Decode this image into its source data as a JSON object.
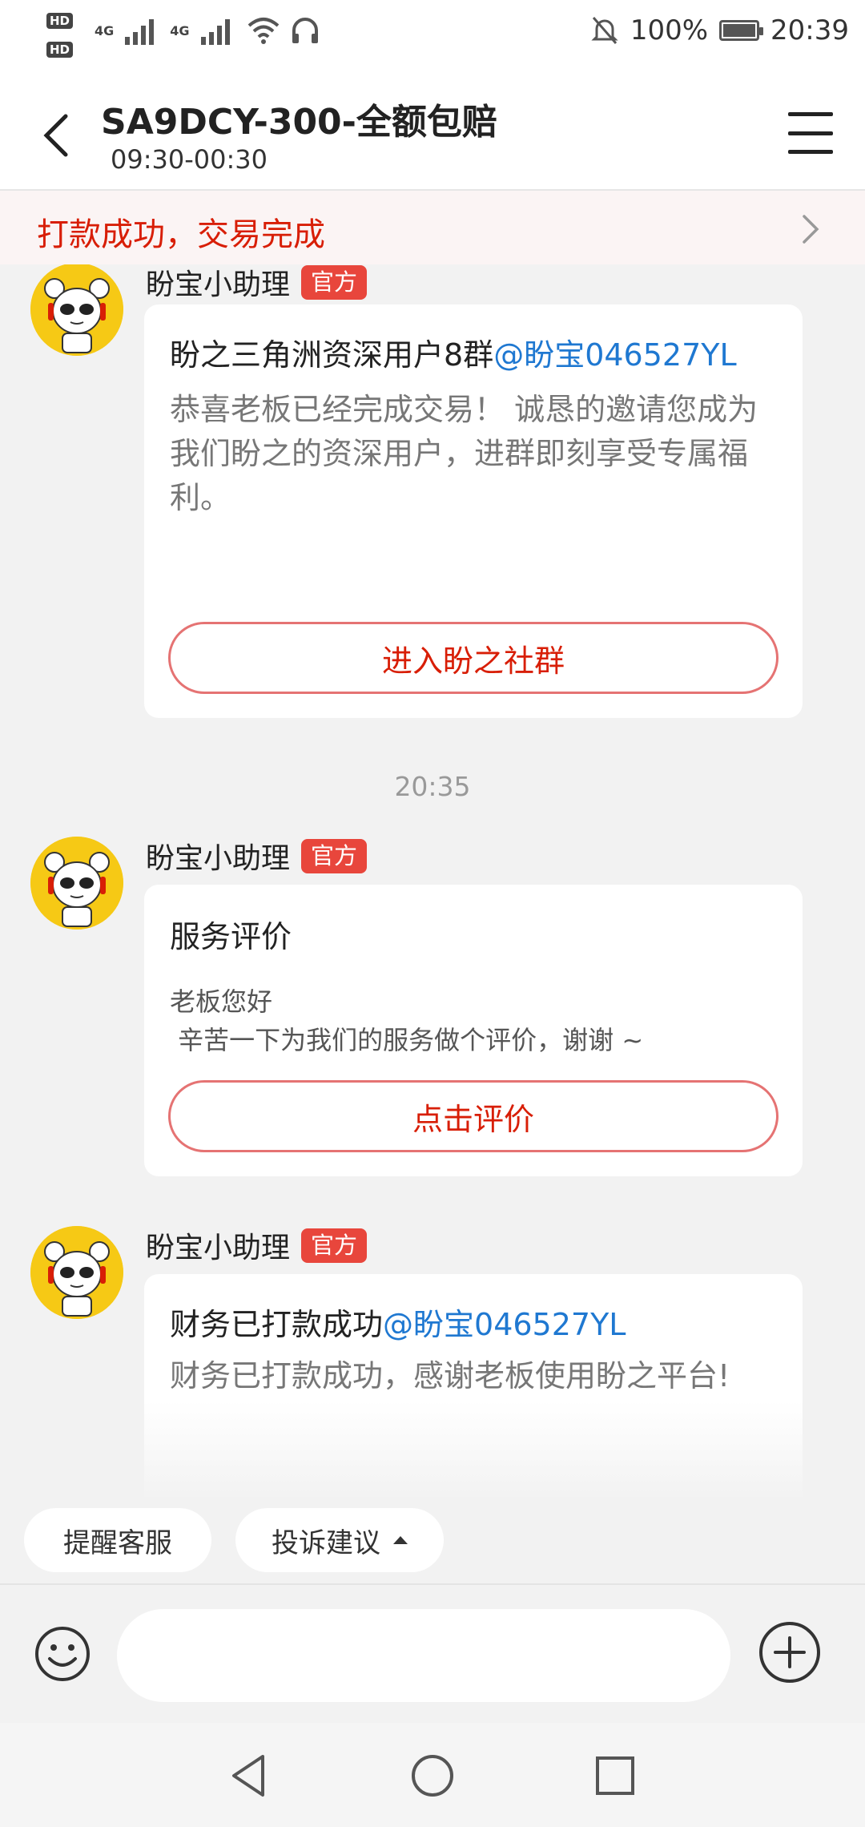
{
  "status_bar": {
    "battery": "100%",
    "battery_level": 1.0,
    "time": "20:39",
    "hd1": "HD",
    "hd2": "HD",
    "network1": "4G",
    "network2": "4G",
    "icons": [
      "signal-icon",
      "signal-icon",
      "wifi-icon",
      "headset-icon",
      "mute-bell-icon",
      "battery-icon"
    ]
  },
  "header": {
    "title": "SA9DCY-300-全额包赔",
    "subtitle": "09:30-00:30"
  },
  "banner": {
    "text": "打款成功，交易完成"
  },
  "messages": [
    {
      "sender": "盼宝小助理",
      "badge": "官方",
      "title": "盼之三角洲资深用户8群",
      "mention": "@盼宝046527YL",
      "body": "恭喜老板已经完成交易！ 诚恳的邀请您成为我们盼之的资深用户，进群即刻享受专属福利。",
      "button": "进入盼之社群"
    },
    {
      "time": "20:35",
      "sender": "盼宝小助理",
      "badge": "官方",
      "title": "服务评价",
      "body_line1": "老板您好",
      "body_line2": " 辛苦一下为我们的服务做个评价，谢谢 ~",
      "button": "点击评价"
    },
    {
      "sender": "盼宝小助理",
      "badge": "官方",
      "title": "财务已打款成功",
      "mention": "@盼宝046527YL",
      "body": "财务已打款成功，感谢老板使用盼之平台!"
    }
  ],
  "quick_actions": [
    {
      "label": "提醒客服"
    },
    {
      "label": "投诉建议"
    }
  ],
  "input": {
    "value": "",
    "placeholder": ""
  },
  "colors": {
    "accent_red": "#d81e06",
    "badge_red": "#e8463c",
    "mention_blue": "#1f78d1",
    "avatar_yellow": "#f6c915"
  }
}
